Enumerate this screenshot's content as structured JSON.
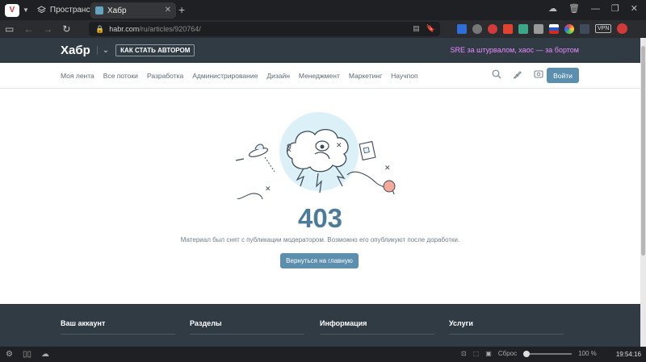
{
  "browser": {
    "spaces_label": "Пространства",
    "tab_title": "Хабр",
    "url_host": "habr.com",
    "url_path": "/ru/articles/920764/",
    "vpn_label": "VPN",
    "zoom_reset_label": "Сброс",
    "zoom_level": "100 %",
    "zoom_fraction": 0.0,
    "clock": "19:54:16"
  },
  "site": {
    "logo": "Хабр",
    "become_author": "КАК СТАТЬ АВТОРОМ",
    "promo": "SRE за штурвалом, хаос — за бортом",
    "nav": [
      "Моя лента",
      "Все потоки",
      "Разработка",
      "Администрирование",
      "Дизайн",
      "Менеджмент",
      "Маркетинг",
      "Научпоп"
    ],
    "login": "Войти"
  },
  "error": {
    "code": "403",
    "message": "Материал был снят с публикации модератором. Возможно его опубликуют после доработки.",
    "home_button": "Вернуться на главную"
  },
  "footer": {
    "columns": [
      "Ваш аккаунт",
      "Разделы",
      "Информация",
      "Услуги"
    ]
  },
  "colors": {
    "header_bg": "#303b44",
    "accent": "#5c8eae",
    "code": "#4c7c99",
    "promo": "#e98aff"
  }
}
